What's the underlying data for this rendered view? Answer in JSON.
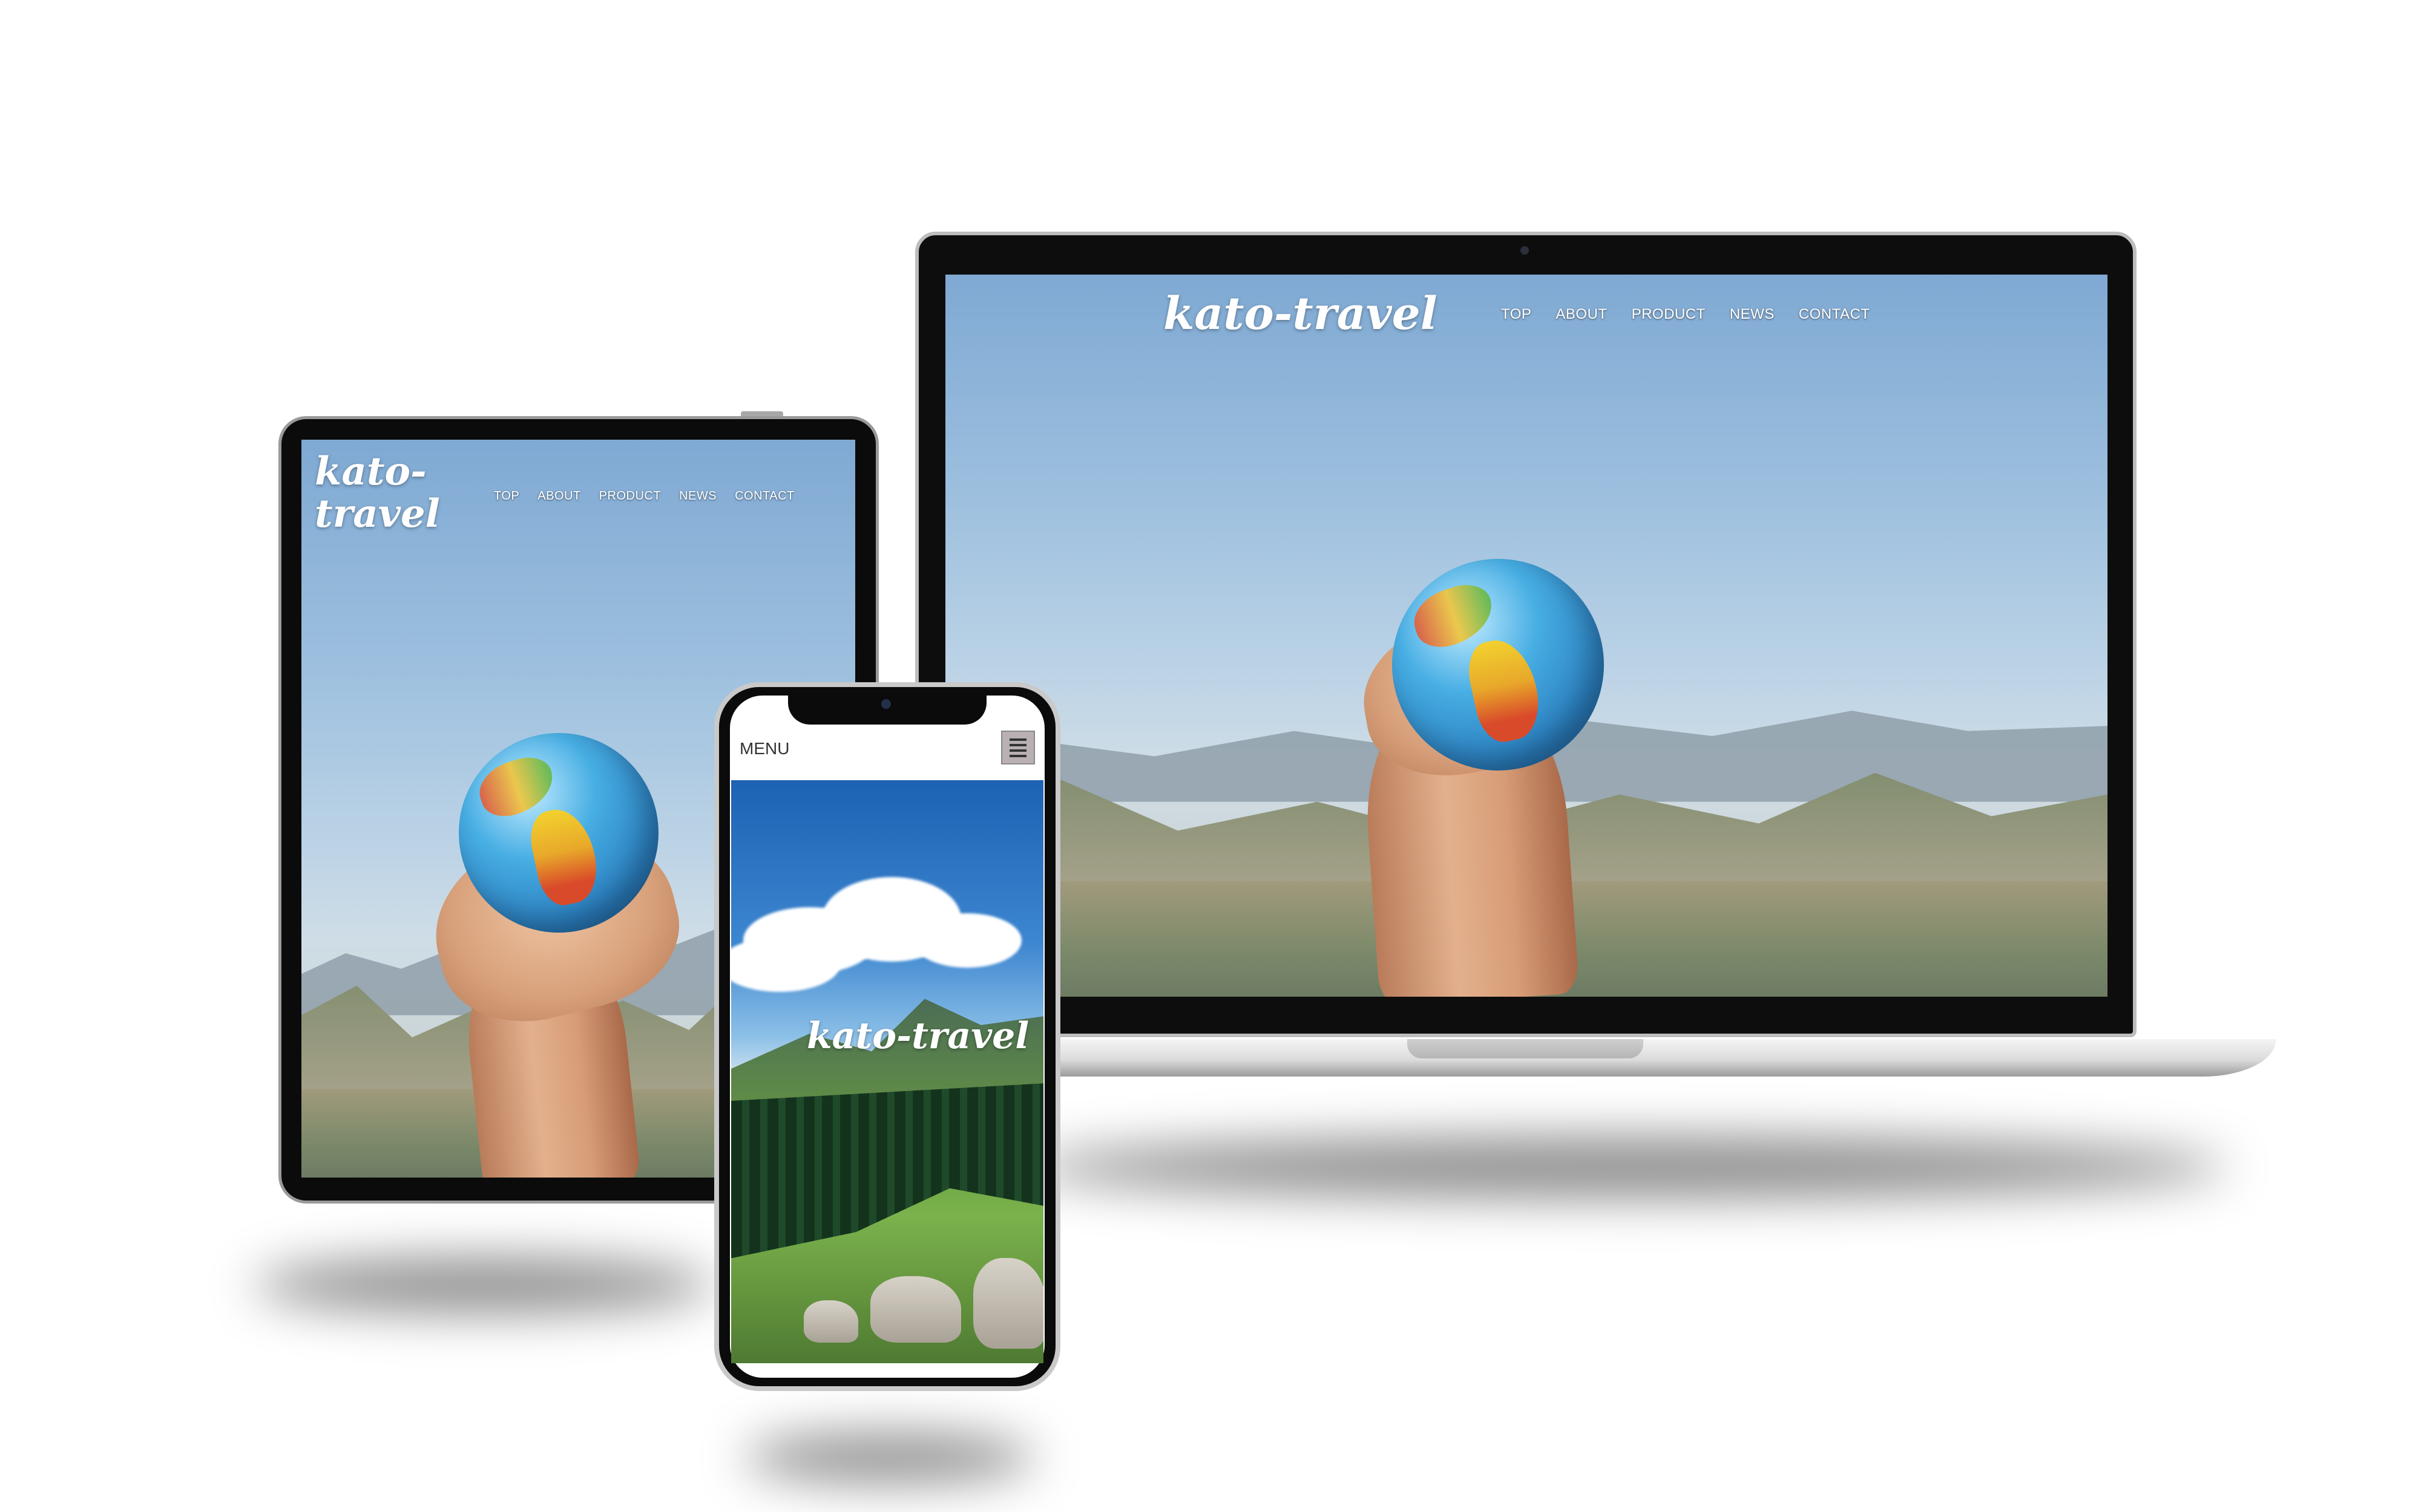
{
  "site": {
    "logo": "kato-travel",
    "logo_line1": "kato-",
    "logo_line2": "travel",
    "nav": [
      "TOP",
      "ABOUT",
      "PRODUCT",
      "NEWS",
      "CONTACT"
    ]
  },
  "mobile": {
    "menu_label": "MENU",
    "logo": "kato-travel"
  }
}
